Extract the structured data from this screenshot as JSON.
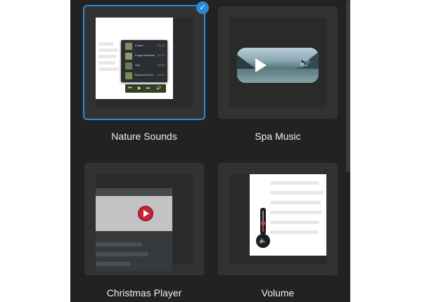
{
  "templates": [
    {
      "id": "nature-sounds",
      "label": "Nature Sounds",
      "selected": true
    },
    {
      "id": "spa-music",
      "label": "Spa Music",
      "selected": false
    },
    {
      "id": "christmas-player",
      "label": "Christmas Player",
      "selected": false
    },
    {
      "id": "volume",
      "label": "Volume",
      "selected": false
    }
  ],
  "selected_check_icon": "check-icon",
  "nature_playlist": [
    {
      "title": "Forest",
      "time": "01:26"
    },
    {
      "title": "Frogs and Birds",
      "time": "02:12"
    },
    {
      "title": "Owl",
      "time": "00:55"
    },
    {
      "title": "Bamboo in the...",
      "time": "01:41"
    }
  ],
  "nature_controls": {
    "prev": "⏮",
    "play": "▶",
    "next": "⏭",
    "volume": "🔊"
  },
  "spa_preview": {
    "play_icon": "play-icon",
    "volume_icon": "🔊"
  },
  "volume_preview": {
    "level": 0.4,
    "icon": "🔈"
  },
  "colors": {
    "panel": "#222222",
    "card": "#323232",
    "selected": "#2b8ad8",
    "xmas_play": "#c2283c",
    "volume_fill": "#d83a3a"
  }
}
